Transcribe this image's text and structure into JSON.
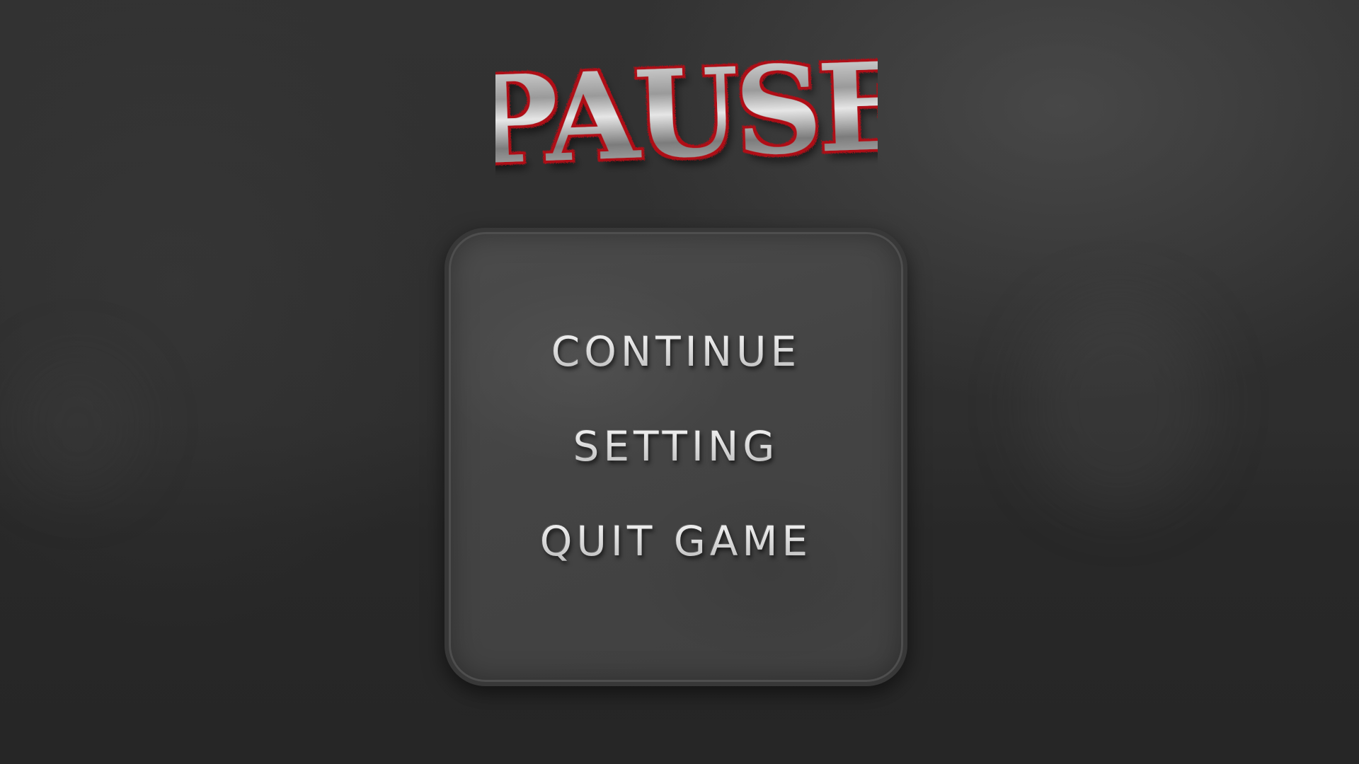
{
  "pause_menu": {
    "title": "PAUSE",
    "title_colors": {
      "fill": "#c9c9c9",
      "outline": "#b01016"
    },
    "items": [
      {
        "label": "CONTINUE"
      },
      {
        "label": "SETTING"
      },
      {
        "label": "QUIT GAME"
      }
    ]
  }
}
